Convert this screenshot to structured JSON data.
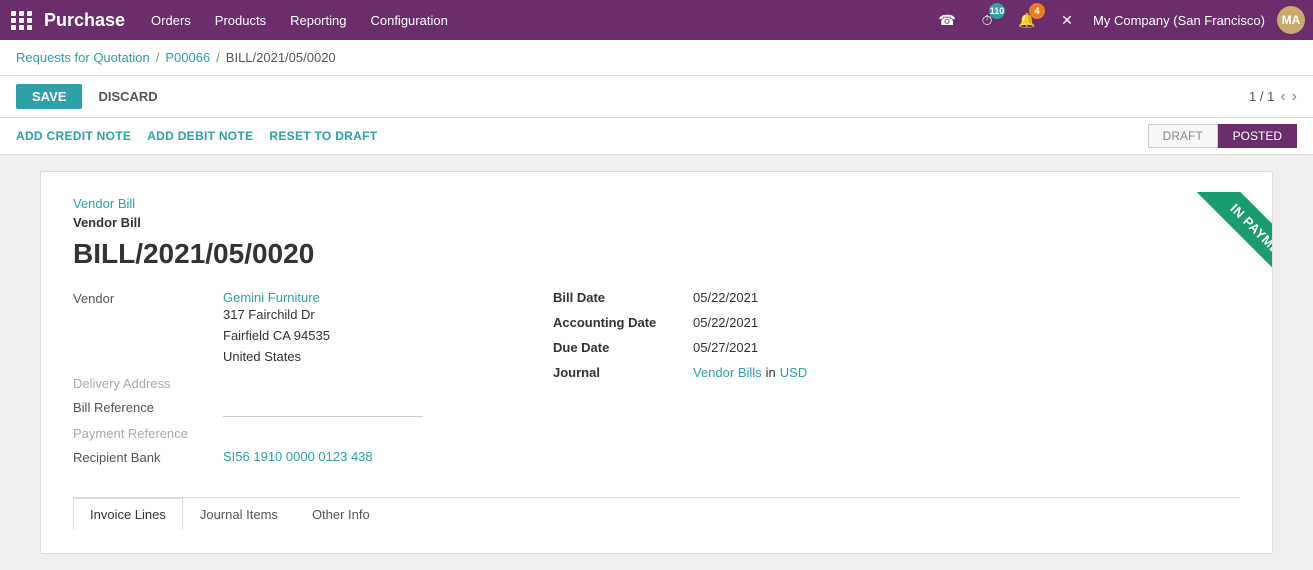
{
  "topnav": {
    "app_title": "Purchase",
    "nav_items": [
      "Orders",
      "Products",
      "Reporting",
      "Configuration"
    ],
    "badge_110": "110",
    "badge_4": "4",
    "company": "My Company (San Francisco)",
    "user": "Mitchell Ag"
  },
  "breadcrumb": {
    "part1": "Requests for Quotation",
    "sep1": "/",
    "part2": "P00066",
    "sep2": "/",
    "current": "BILL/2021/05/0020"
  },
  "action_bar": {
    "save_label": "SAVE",
    "discard_label": "DISCARD",
    "pager": "1 / 1"
  },
  "secondary_toolbar": {
    "btn1": "ADD CREDIT NOTE",
    "btn2": "ADD DEBIT NOTE",
    "btn3": "RESET TO DRAFT"
  },
  "status": {
    "draft": "DRAFT",
    "posted": "POSTED"
  },
  "bill": {
    "doc_type_link": "Vendor Bill",
    "doc_title": "Vendor Bill",
    "doc_number": "BILL/2021/05/0020",
    "vendor_label": "Vendor",
    "vendor_name": "Gemini Furniture",
    "vendor_address1": "317 Fairchild Dr",
    "vendor_address2": "Fairfield CA 94535",
    "vendor_address3": "United States",
    "delivery_label": "Delivery Address",
    "bill_ref_label": "Bill Reference",
    "payment_ref_label": "Payment Reference",
    "recipient_bank_label": "Recipient Bank",
    "recipient_bank_value": "SI56 1910 0000 0123 438",
    "bill_date_label": "Bill Date",
    "bill_date_value": "05/22/2021",
    "accounting_date_label": "Accounting Date",
    "accounting_date_value": "05/22/2021",
    "due_date_label": "Due Date",
    "due_date_value": "05/27/2021",
    "journal_label": "Journal",
    "journal_value": "Vendor Bills",
    "journal_in": "in",
    "journal_currency": "USD",
    "in_payment": "IN PAYMENT"
  },
  "tabs": {
    "tab1": "Invoice Lines",
    "tab2": "Journal Items",
    "tab3": "Other Info"
  }
}
